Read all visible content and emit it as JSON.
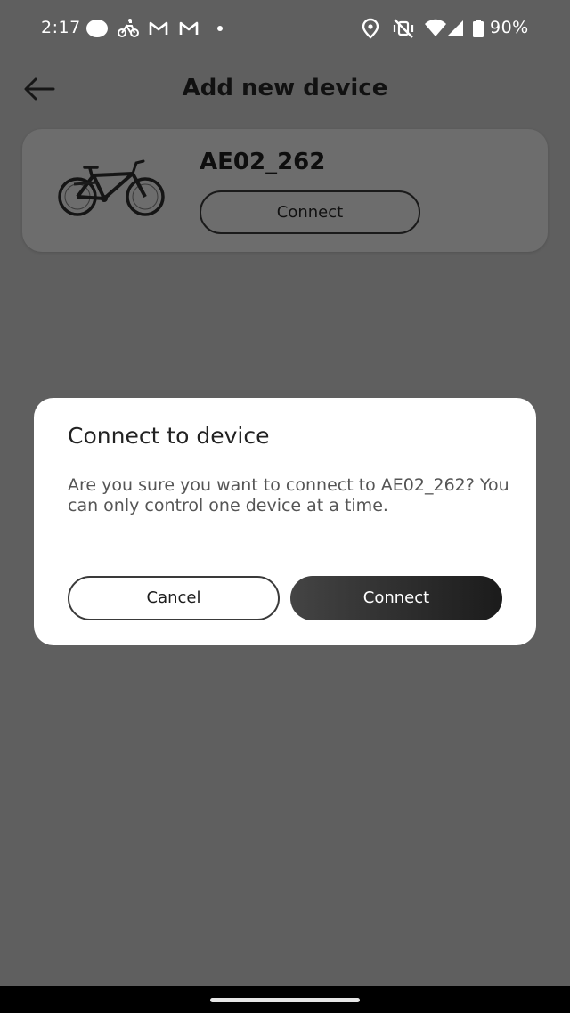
{
  "status_bar": {
    "time": "2:17",
    "battery_percent": "90%",
    "icons": [
      "circle-icon",
      "bike-icon",
      "gmail-icon",
      "gmail-icon",
      "dot-icon",
      "location-icon",
      "vibrate-off-icon",
      "wifi-icon",
      "signal-icon",
      "battery-icon"
    ]
  },
  "app_bar": {
    "title": "Add new device"
  },
  "device_card": {
    "name": "AE02_262",
    "connect_label": "Connect"
  },
  "dialog": {
    "title": "Connect to device",
    "message": "Are you sure you want to connect to AE02_262? You can only control one device at a time.",
    "cancel_label": "Cancel",
    "confirm_label": "Connect"
  },
  "colors": {
    "overlay_bg": "#5f5f5f",
    "dialog_bg": "#ffffff",
    "primary_button": "#2b2b2b"
  }
}
